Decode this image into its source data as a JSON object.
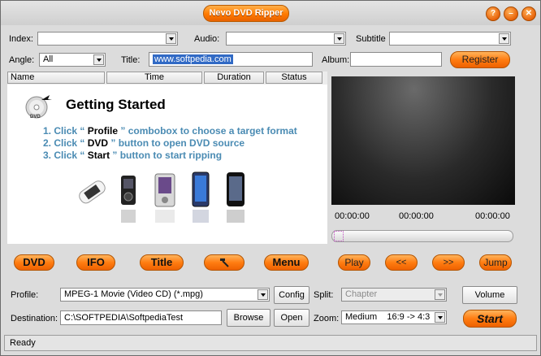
{
  "window": {
    "title": "Nevo DVD Ripper"
  },
  "titlebar_buttons": [
    {
      "name": "help",
      "glyph": "?"
    },
    {
      "name": "minimize",
      "glyph": "–"
    },
    {
      "name": "close",
      "glyph": "✕"
    }
  ],
  "fields": {
    "index_label": "Index:",
    "index_value": "",
    "audio_label": "Audio:",
    "audio_value": "",
    "subtitle_label": "Subtitle",
    "subtitle_value": "",
    "angle_label": "Angle:",
    "angle_value": "All",
    "title_label": "Title:",
    "title_value": "www.softpedia.com",
    "album_label": "Album:",
    "album_value": "",
    "register_label": "Register"
  },
  "grid": {
    "columns": [
      "Name",
      "Time",
      "Duration",
      "Status"
    ]
  },
  "guide": {
    "heading": "Getting  Started",
    "disc_label": "DVD",
    "steps": [
      {
        "num": "1.",
        "pre": "Click “ ",
        "key": "Profile",
        "post": " ” combobox to choose a target format"
      },
      {
        "num": "2.",
        "pre": "Click “ ",
        "key": "DVD",
        "post": " ” button to open DVD source"
      },
      {
        "num": "3.",
        "pre": "Click “ ",
        "key": "Start",
        "post": " ” button to start ripping"
      }
    ]
  },
  "player": {
    "time_current": "00:00:00",
    "time_mid": "00:00:00",
    "time_total": "00:00:00",
    "seek_fraction": 0
  },
  "toolbar": {
    "dvd": "DVD",
    "ifo": "IFO",
    "title": "Title",
    "menu": "Menu",
    "play": "Play",
    "rewind": "<<",
    "forward": ">>",
    "jump": "Jump"
  },
  "bottom": {
    "profile_label": "Profile:",
    "profile_value": "MPEG-1 Movie (Video CD) (*.mpg)",
    "config_label": "Config",
    "split_label": "Split:",
    "split_value": "Chapter",
    "volume_label": "Volume",
    "destination_label": "Destination:",
    "destination_value": "C:\\SOFTPEDIA\\SoftpediaTest",
    "browse_label": "Browse",
    "open_label": "Open",
    "zoom_label": "Zoom:",
    "zoom_value": "Medium    16:9 -> 4:3",
    "start_label": "Start"
  },
  "status": {
    "text": "Ready"
  },
  "colors": {
    "accent_orange": "#ff7d12",
    "window_bg": "#dcdcdc",
    "step_blue": "#4a8bb3",
    "selection_blue": "#316ac5"
  }
}
